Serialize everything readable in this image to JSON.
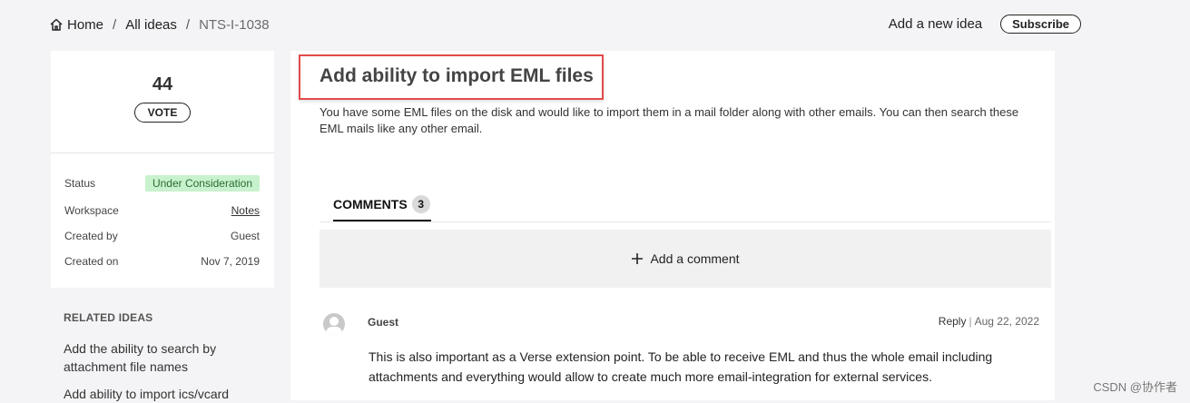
{
  "breadcrumb": {
    "home": "Home",
    "all_ideas": "All ideas",
    "current": "NTS-I-1038",
    "separator": "/"
  },
  "top_actions": {
    "add_idea": "Add a new idea",
    "subscribe": "Subscribe"
  },
  "vote": {
    "count": "44",
    "button": "VOTE"
  },
  "meta": {
    "status_label": "Status",
    "status_value": "Under Consideration",
    "workspace_label": "Workspace",
    "workspace_value": "Notes",
    "created_by_label": "Created by",
    "created_by_value": "Guest",
    "created_on_label": "Created on",
    "created_on_value": "Nov 7, 2019"
  },
  "related": {
    "title": "RELATED IDEAS",
    "items": [
      "Add the ability to search by attachment file names",
      "Add ability to import ics/vcard"
    ]
  },
  "idea": {
    "title": "Add ability to import EML files",
    "description": "You have some EML files on the disk and would like to import them in a mail folder along with other emails. You can then search these EML mails like any other email."
  },
  "comments": {
    "tab_label": "COMMENTS",
    "count": "3",
    "add_label": "Add a comment",
    "items": [
      {
        "author": "Guest",
        "reply": "Reply",
        "date": "Aug 22, 2022",
        "body": "This is also important as a Verse extension point. To be able to receive EML and thus the whole email including attachments and everything would allow to create much more email-integration for external services."
      }
    ]
  },
  "watermark": "CSDN @协作者",
  "colors": {
    "highlight_border": "#e34b4b",
    "status_bg": "#c8f2cd"
  },
  "icons": {
    "home": "home-icon",
    "plus": "plus-icon",
    "avatar": "user-avatar-icon"
  }
}
